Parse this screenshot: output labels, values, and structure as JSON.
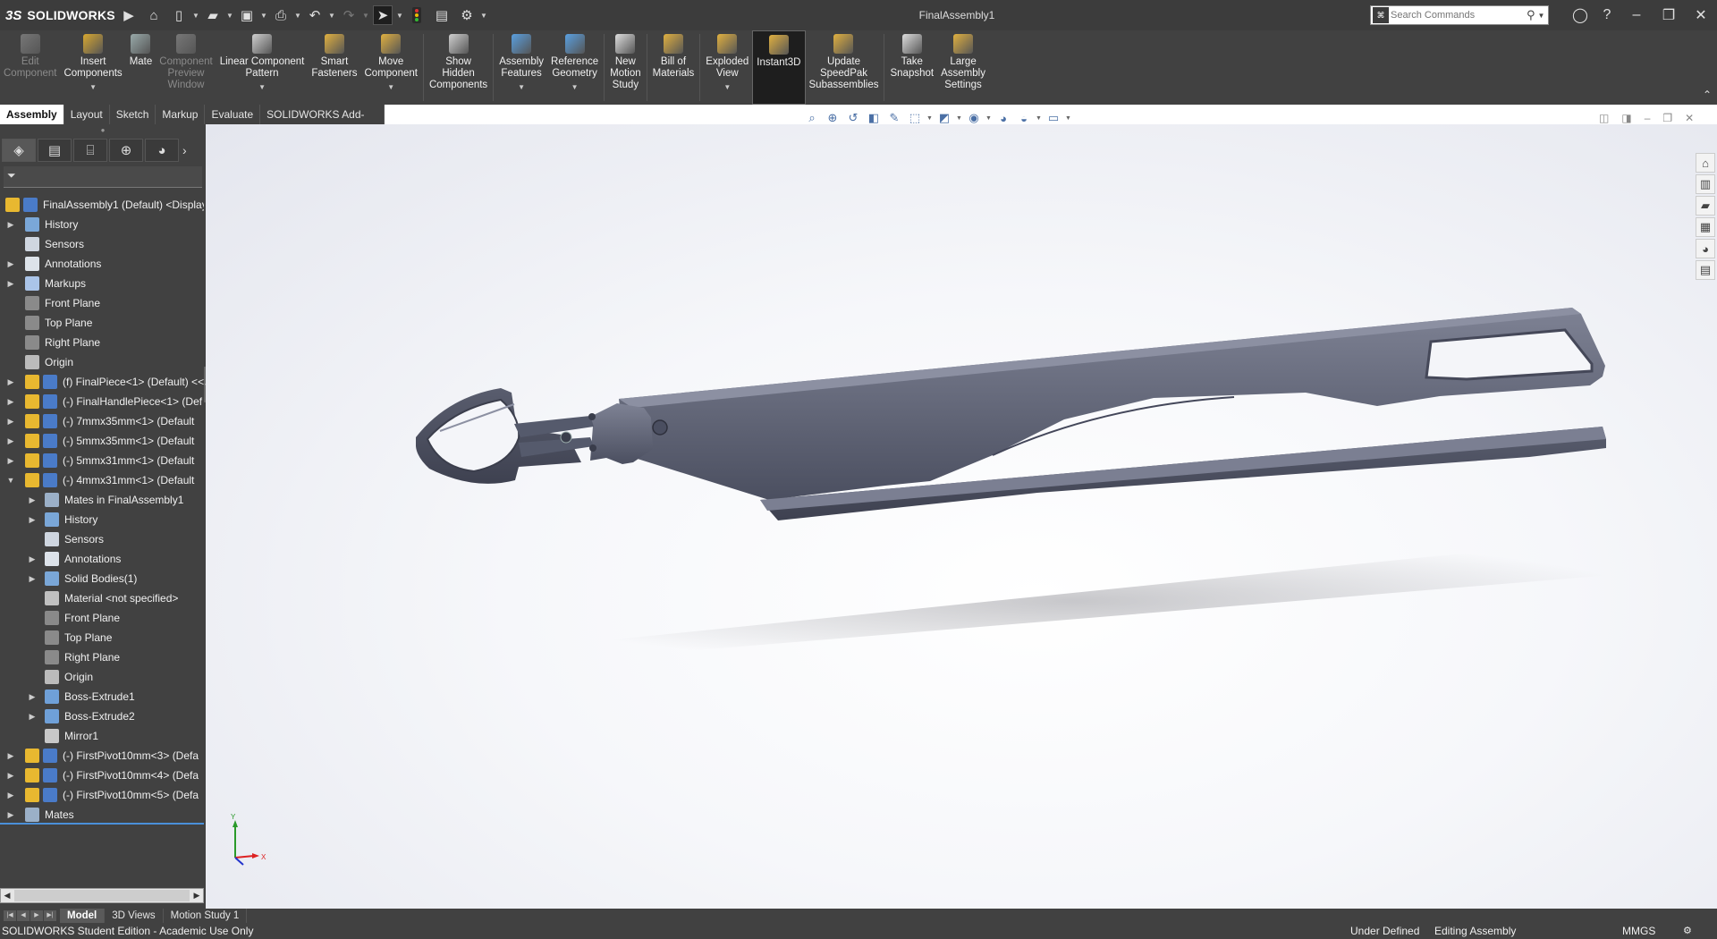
{
  "app": {
    "brand_ds": "3S",
    "brand_name": "SOLIDWORKS",
    "document_title": "FinalAssembly1",
    "search_placeholder": "Search Commands"
  },
  "command_manager": [
    {
      "label": "Edit Component",
      "lines": [
        "Edit",
        "Component"
      ],
      "enabled": false,
      "dropdown": false
    },
    {
      "label": "Insert Components",
      "lines": [
        "Insert",
        "Components"
      ],
      "enabled": true,
      "dropdown": true
    },
    {
      "label": "Mate",
      "lines": [
        "Mate"
      ],
      "enabled": true,
      "dropdown": false
    },
    {
      "label": "Component Preview Window",
      "lines": [
        "Component",
        "Preview",
        "Window"
      ],
      "enabled": false,
      "dropdown": false
    },
    {
      "label": "Linear Component Pattern",
      "lines": [
        "Linear Component",
        "Pattern"
      ],
      "enabled": true,
      "dropdown": true
    },
    {
      "label": "Smart Fasteners",
      "lines": [
        "Smart",
        "Fasteners"
      ],
      "enabled": true,
      "dropdown": false
    },
    {
      "label": "Move Component",
      "lines": [
        "Move",
        "Component"
      ],
      "enabled": true,
      "dropdown": true
    },
    {
      "label": "Show Hidden Components",
      "lines": [
        "Show",
        "Hidden",
        "Components"
      ],
      "enabled": true,
      "dropdown": false
    },
    {
      "label": "Assembly Features",
      "lines": [
        "Assembly",
        "Features"
      ],
      "enabled": true,
      "dropdown": true
    },
    {
      "label": "Reference Geometry",
      "lines": [
        "Reference",
        "Geometry"
      ],
      "enabled": true,
      "dropdown": true
    },
    {
      "label": "New Motion Study",
      "lines": [
        "New",
        "Motion",
        "Study"
      ],
      "enabled": true,
      "dropdown": false
    },
    {
      "label": "Bill of Materials",
      "lines": [
        "Bill of",
        "Materials"
      ],
      "enabled": true,
      "dropdown": false
    },
    {
      "label": "Exploded View",
      "lines": [
        "Exploded",
        "View"
      ],
      "enabled": true,
      "dropdown": true
    },
    {
      "label": "Instant3D",
      "lines": [
        "Instant3D"
      ],
      "enabled": true,
      "dropdown": false,
      "active": true
    },
    {
      "label": "Update SpeedPak Subassemblies",
      "lines": [
        "Update",
        "SpeedPak",
        "Subassemblies"
      ],
      "enabled": true,
      "dropdown": false
    },
    {
      "label": "Take Snapshot",
      "lines": [
        "Take",
        "Snapshot"
      ],
      "enabled": true,
      "dropdown": false
    },
    {
      "label": "Large Assembly Settings",
      "lines": [
        "Large",
        "Assembly",
        "Settings"
      ],
      "enabled": true,
      "dropdown": false
    }
  ],
  "tabs": [
    "Assembly",
    "Layout",
    "Sketch",
    "Markup",
    "Evaluate",
    "SOLIDWORKS Add-Ins"
  ],
  "active_tab": "Assembly",
  "feature_tree": [
    {
      "label": "FinalAssembly1 (Default) <Display",
      "depth": 0,
      "expander": "",
      "icon": "assembly"
    },
    {
      "label": "History",
      "depth": 1,
      "expander": "▶",
      "icon": "history"
    },
    {
      "label": "Sensors",
      "depth": 1,
      "expander": "",
      "icon": "sensor"
    },
    {
      "label": "Annotations",
      "depth": 1,
      "expander": "▶",
      "icon": "annotation"
    },
    {
      "label": "Markups",
      "depth": 1,
      "expander": "▶",
      "icon": "markup"
    },
    {
      "label": "Front Plane",
      "depth": 1,
      "expander": "",
      "icon": "plane"
    },
    {
      "label": "Top Plane",
      "depth": 1,
      "expander": "",
      "icon": "plane"
    },
    {
      "label": "Right Plane",
      "depth": 1,
      "expander": "",
      "icon": "plane"
    },
    {
      "label": "Origin",
      "depth": 1,
      "expander": "",
      "icon": "origin"
    },
    {
      "label": "(f) FinalPiece<1> (Default) <<",
      "depth": 1,
      "expander": "▶",
      "icon": "part"
    },
    {
      "label": "(-) FinalHandlePiece<1> (Def",
      "depth": 1,
      "expander": "▶",
      "icon": "part"
    },
    {
      "label": "(-) 7mmx35mm<1> (Default",
      "depth": 1,
      "expander": "▶",
      "icon": "part"
    },
    {
      "label": "(-) 5mmx35mm<1> (Default",
      "depth": 1,
      "expander": "▶",
      "icon": "part"
    },
    {
      "label": "(-) 5mmx31mm<1> (Default",
      "depth": 1,
      "expander": "▶",
      "icon": "part"
    },
    {
      "label": "(-) 4mmx31mm<1> (Default",
      "depth": 1,
      "expander": "▼",
      "icon": "part"
    },
    {
      "label": "Mates in FinalAssembly1",
      "depth": 2,
      "expander": "▶",
      "icon": "mates"
    },
    {
      "label": "History",
      "depth": 2,
      "expander": "▶",
      "icon": "history"
    },
    {
      "label": "Sensors",
      "depth": 2,
      "expander": "",
      "icon": "sensor"
    },
    {
      "label": "Annotations",
      "depth": 2,
      "expander": "▶",
      "icon": "annotation"
    },
    {
      "label": "Solid Bodies(1)",
      "depth": 2,
      "expander": "▶",
      "icon": "solid-body"
    },
    {
      "label": "Material <not specified>",
      "depth": 2,
      "expander": "",
      "icon": "material"
    },
    {
      "label": "Front Plane",
      "depth": 2,
      "expander": "",
      "icon": "plane"
    },
    {
      "label": "Top Plane",
      "depth": 2,
      "expander": "",
      "icon": "plane"
    },
    {
      "label": "Right Plane",
      "depth": 2,
      "expander": "",
      "icon": "plane"
    },
    {
      "label": "Origin",
      "depth": 2,
      "expander": "",
      "icon": "origin"
    },
    {
      "label": "Boss-Extrude1",
      "depth": 2,
      "expander": "▶",
      "icon": "extrude"
    },
    {
      "label": "Boss-Extrude2",
      "depth": 2,
      "expander": "▶",
      "icon": "extrude"
    },
    {
      "label": "Mirror1",
      "depth": 2,
      "expander": "",
      "icon": "mirror"
    },
    {
      "label": "(-) FirstPivot10mm<3> (Defa",
      "depth": 1,
      "expander": "▶",
      "icon": "part"
    },
    {
      "label": "(-) FirstPivot10mm<4> (Defa",
      "depth": 1,
      "expander": "▶",
      "icon": "part"
    },
    {
      "label": "(-) FirstPivot10mm<5> (Defa",
      "depth": 1,
      "expander": "▶",
      "icon": "part"
    },
    {
      "label": "Mates",
      "depth": 1,
      "expander": "▶",
      "icon": "mates"
    }
  ],
  "triad": {
    "y_label": "Y",
    "x_label": "X"
  },
  "bottom_tabs": [
    "Model",
    "3D Views",
    "Motion Study 1"
  ],
  "active_bottom_tab": "Model",
  "status": {
    "left": "SOLIDWORKS Student Edition - Academic Use Only",
    "state": "Under Defined",
    "mode": "Editing Assembly",
    "units": "MMGS"
  },
  "colors": {
    "chrome": "#414141",
    "titlebar": "#3c3c3c",
    "part_metal": "#5d6173",
    "accent_blue": "#4a90d9",
    "component_yellow": "#e8b830"
  }
}
